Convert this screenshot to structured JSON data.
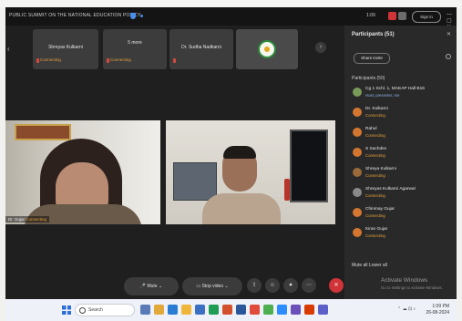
{
  "window": {
    "title": "PUBLIC SUMMIT ON THE NATIONAL EDUCATION POLICY",
    "signin": "Sign in",
    "timer": "1:09"
  },
  "video_strip": {
    "tiles": [
      {
        "name": "Shreyas Kulkarni",
        "status": "Connecting"
      },
      {
        "sub": "5 more",
        "name": "",
        "status": "Connecting"
      },
      {
        "name": "Dr. Sudha Nadkarni",
        "status": ""
      }
    ]
  },
  "main_videos": {
    "left_name": "Dr. Gujar",
    "left_status": "Connecting"
  },
  "participants": {
    "title": "Participants (51)",
    "invite": "Share invite",
    "group_label": "Participants (50)",
    "list": [
      {
        "name": "Cg 1 Schl. 1, MAEAP Hall B16",
        "sub": "Host, presenter, me"
      },
      {
        "name": "Dr. Kulkarni",
        "sub": "Connecting"
      },
      {
        "name": "Rahul",
        "sub": "Connecting"
      },
      {
        "name": "S Sachdev",
        "sub": "Connecting"
      },
      {
        "name": "Shreya Kulkarni",
        "sub": "Connecting"
      },
      {
        "name": "Shreyas Kulkarni Agarwal",
        "sub": "Connecting"
      },
      {
        "name": "Chinmay Gujar",
        "sub": "Connecting"
      },
      {
        "name": "Kiran Gujar",
        "sub": "Connecting"
      }
    ],
    "mute_all": "Mute all   Lower all",
    "activate_title": "Activate Windows",
    "activate_sub": "Go to Settings to activate Windows."
  },
  "controls": {
    "mute": "Mute",
    "video": "Stop video"
  },
  "taskbar": {
    "search": "Search",
    "time": "1:09 PM",
    "date": "26-08-2024"
  },
  "colors": {
    "accent_orange": "#e8a33a",
    "leave_red": "#d13438",
    "panel_bg": "#292929"
  }
}
